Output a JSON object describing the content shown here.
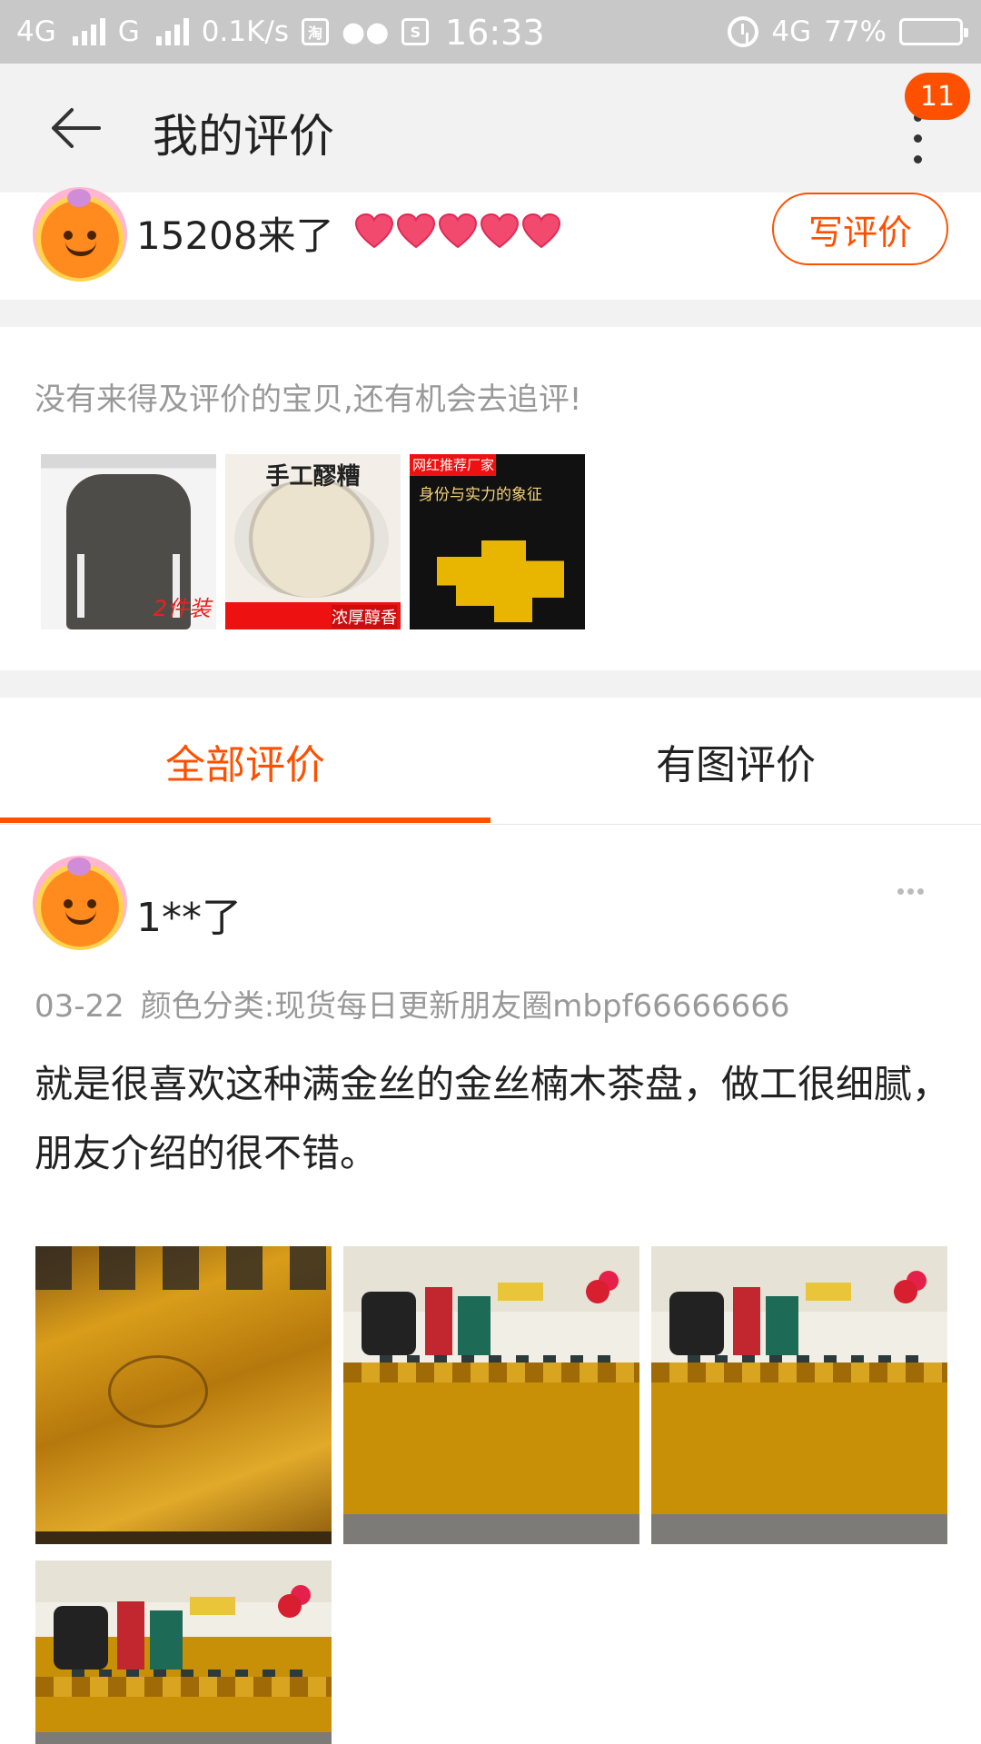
{
  "status_bar": {
    "network_left": "4G",
    "network_mid": "G",
    "speed": "0.1K/s",
    "time": "16:33",
    "network_right": "4G",
    "battery": "77%",
    "icons": [
      "taobao-icon",
      "wechat-icon",
      "sim-icon",
      "alarm-icon",
      "battery-icon"
    ]
  },
  "header": {
    "title": "我的评价",
    "badge_count": "11"
  },
  "user": {
    "name": "15208来了",
    "hearts": 5,
    "write_review_label": "写评价"
  },
  "followup": {
    "text": "没有来得及评价的宝贝,还有机会去追评!",
    "items": [
      {
        "tag": "2件装"
      },
      {
        "title": "手工醪糟",
        "band_text": "浓厚醇香"
      },
      {
        "banner": "网红推荐厂家",
        "subtitle": "身份与实力的象征"
      }
    ]
  },
  "tabs": {
    "all": "全部评价",
    "photos": "有图评价",
    "active": "all"
  },
  "review": {
    "reviewer": "1**了",
    "date": "03-22",
    "variant": "颜色分类:现货每日更新朋友圈mbpf66666666",
    "text": "就是很喜欢这种满金丝的金丝楠木茶盘，做工很细腻，朋友介绍的很不错。",
    "photo_count": 4
  },
  "colors": {
    "accent": "#ff5000",
    "status_bar_bg": "#c8c8c8",
    "header_bg": "#f2f2f2",
    "muted_text": "#999999"
  }
}
